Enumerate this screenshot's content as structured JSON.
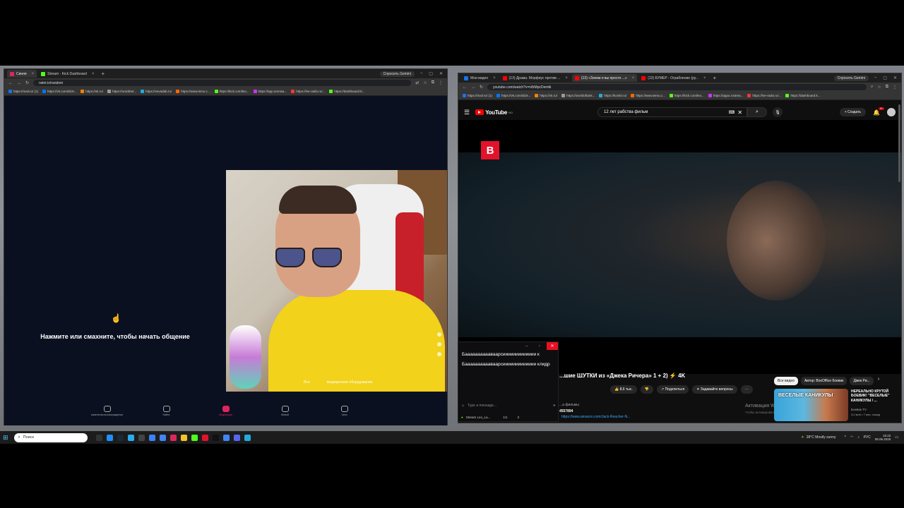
{
  "left_window": {
    "tabs": [
      {
        "label": "Синяя",
        "color": "#e0245e",
        "active": true
      },
      {
        "label": "Stream - Kick Dashboard",
        "color": "#53fc18",
        "active": false
      }
    ],
    "gemini": "Спросить Gemini",
    "url": "rwlet.tv/random",
    "bookmarks": [
      "https://mail.ru/ (1)",
      "https://vk.com/id19...",
      "https://ok.ru/",
      "https://unickbet...",
      "https://vevadab.ru/",
      "https://www.temu.c...",
      "https://kick.com/leo...",
      "https://app.omnisa...",
      "https://lve-radio.ru/...",
      "https://dashboard.kl..."
    ],
    "prompt": "Нажмите или смахните, чтобы начать общение",
    "cam_overlay": [
      "Все",
      "медицинское оборудование"
    ],
    "bottom_nav": [
      {
        "label": "изменения вознаграждения",
        "active": false
      },
      {
        "label": "Найти",
        "active": false
      },
      {
        "label": "Модерация",
        "active": true
      },
      {
        "label": "Живой",
        "active": false
      },
      {
        "label": "Чаты",
        "active": false
      }
    ]
  },
  "right_window": {
    "tabs": [
      {
        "label": "Мои видео",
        "color": "#1a73e8",
        "active": false
      },
      {
        "label": "(13) Драма. Морфиус против ...",
        "color": "#ff0000",
        "active": false
      },
      {
        "label": "(13) «Зачем я вы просто ...»",
        "color": "#ff0000",
        "active": true
      },
      {
        "label": "(13) БУМЕР - Ограбление (ру...",
        "color": "#ff0000",
        "active": false
      }
    ],
    "gemini": "Спросить Gemini",
    "url": "youtube.com/watch?v=n8rMpcDemtk",
    "bookmarks": [
      "https://mail.ru/ (1)",
      "https://vk.com/id19...",
      "https://ok.ru/",
      "https://worldoftank...",
      "https://kombi.ru/",
      "https://www.temu.c...",
      "https://kick.com/leo...",
      "https://appu.rostrea...",
      "https://lve-radio.ru/...",
      "https://dashboard.k..."
    ],
    "youtube": {
      "logo": "YouTube",
      "region": "NO",
      "search_value": "12 лет рабства фильм",
      "create": "Создать",
      "notifications": "9+"
    },
    "video": {
      "title": "...шие ШУТКИ из «Джека Ричера» 1 + 2) ⚡ 4K",
      "likes": "8,6 тыс.",
      "share": "Поделиться",
      "ask": "Задавайте вопросы",
      "channel_text": "...а фильмы",
      "channel_num": "4557894",
      "link": "https://www.amazon.com/Jack-Reacher-N..."
    },
    "activation": "Активация Windows",
    "activation_sub": "Чтобы активировать Windows, перейдите в раздел...",
    "chips": [
      "Все видео",
      "Автор: BoxOffice боевик",
      "Джек Ри..."
    ],
    "recommendation": {
      "thumb_text": "ВЕСЕЛЫЕ КАНИКУЛЫ",
      "title": "НЕРЕАЛЬНО КРУТОЙ БОЕВИК! \"ВЕСЕЛЫЕ\" КАНИКУЛЫ / ...",
      "channel": "Боевик TV",
      "meta": "3,2 млн • 7 мес. назад"
    }
  },
  "chat_popup": {
    "messages": [
      "Бааааааааааваарсиииииииииииии к",
      "Бааааааааааваарсиииииииииииии клидр"
    ],
    "input_placeholder": "Type a message...",
    "footer_name": "Stream Leo_La...",
    "footer_count_a": "1/1",
    "footer_count_b": "3"
  },
  "taskbar": {
    "search_placeholder": "Поиск",
    "weather": "28°C   Mostly sunny",
    "lang": "РУС",
    "time": "15:22",
    "date": "08.06.2025"
  }
}
